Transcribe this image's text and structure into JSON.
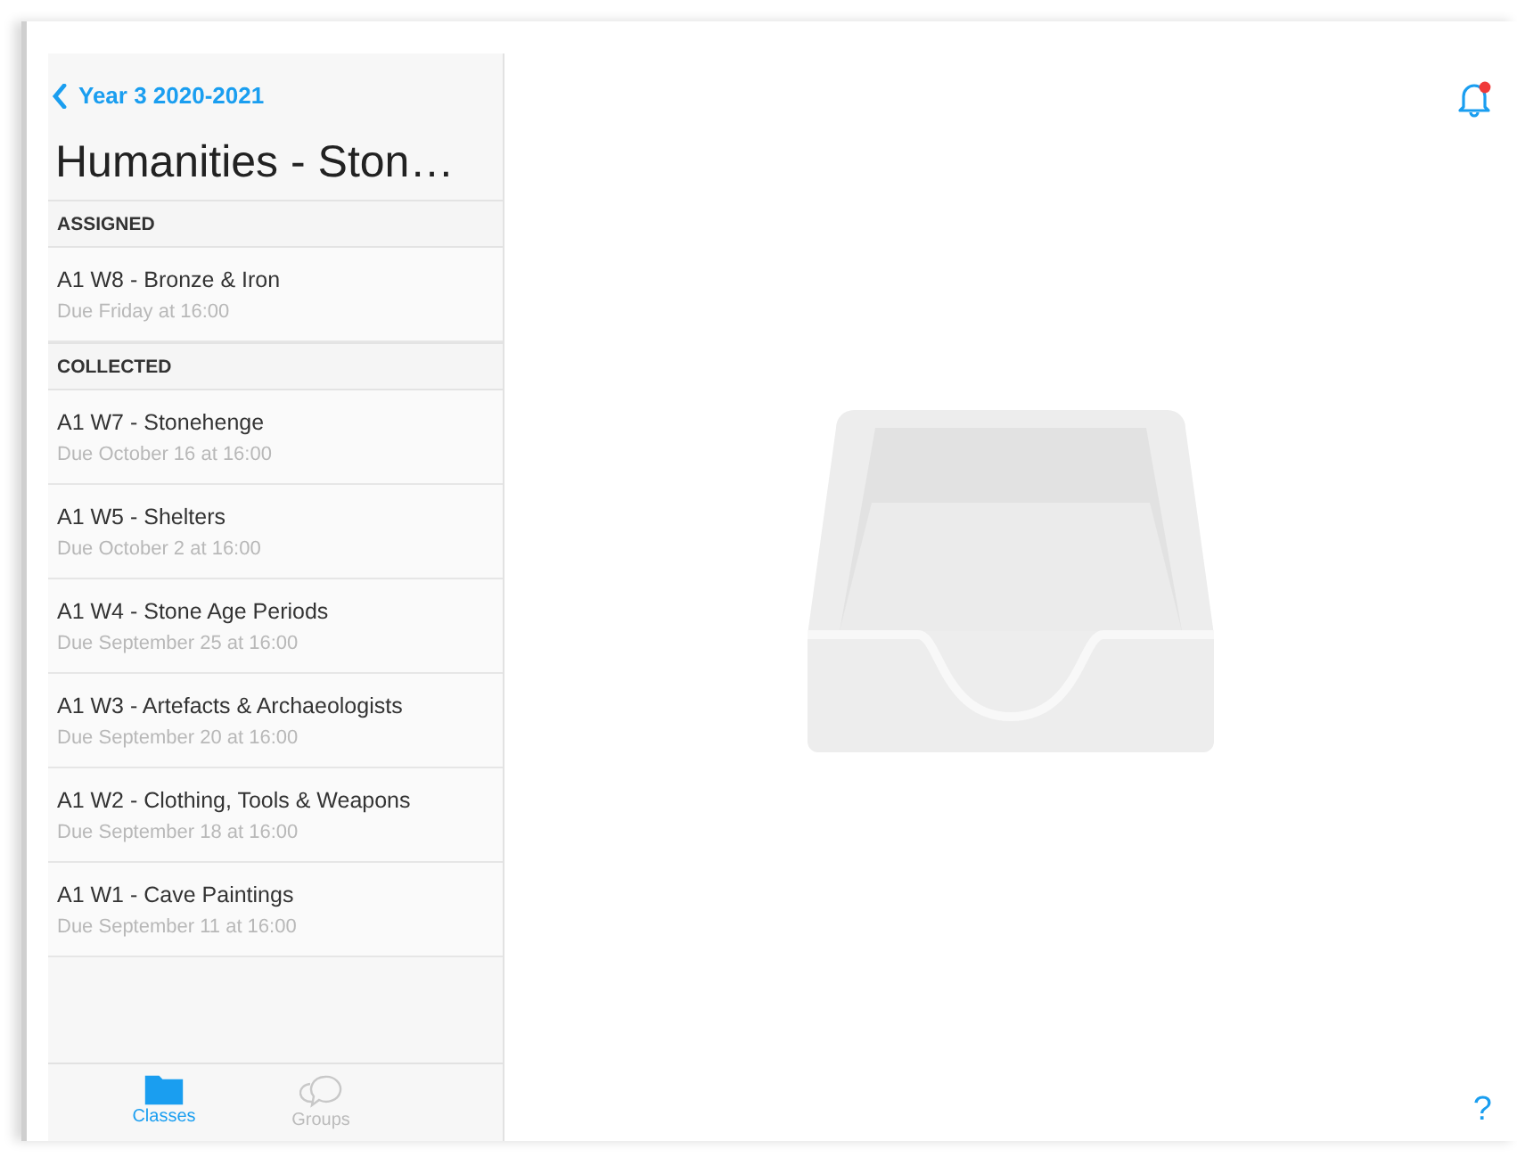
{
  "nav": {
    "back_label": "Year 3 2020-2021",
    "title": "Humanities - Ston…"
  },
  "sections": [
    {
      "header": "ASSIGNED",
      "items": [
        {
          "title": "A1 W8 - Bronze & Iron",
          "due": "Due Friday at 16:00"
        }
      ]
    },
    {
      "header": "COLLECTED",
      "items": [
        {
          "title": "A1 W7 - Stonehenge",
          "due": "Due October 16 at 16:00"
        },
        {
          "title": "A1 W5 - Shelters",
          "due": "Due October 2 at 16:00"
        },
        {
          "title": "A1 W4 - Stone Age Periods",
          "due": "Due September 25 at 16:00"
        },
        {
          "title": "A1 W3 - Artefacts & Archaeologists",
          "due": "Due September 20 at 16:00"
        },
        {
          "title": "A1 W2 - Clothing, Tools & Weapons",
          "due": "Due September 18 at 16:00"
        },
        {
          "title": "A1 W1 - Cave Paintings",
          "due": "Due September 11 at 16:00"
        }
      ]
    }
  ],
  "tabs": [
    {
      "label": "Classes",
      "kind": "classes",
      "selected": true
    },
    {
      "label": "Groups",
      "kind": "groups",
      "selected": false
    }
  ],
  "notifications": {
    "unread": true
  },
  "help": {
    "label": "?"
  }
}
